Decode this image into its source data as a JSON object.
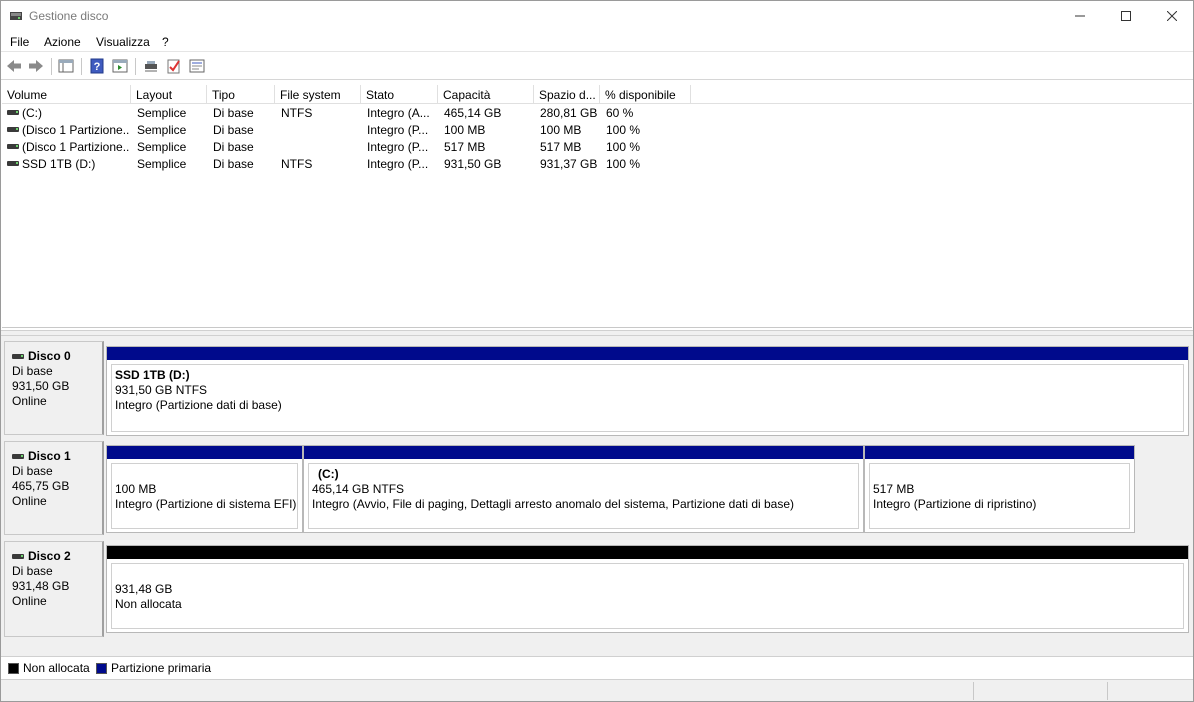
{
  "window": {
    "title": "Gestione disco",
    "controls": {
      "minimize": "minimize-icon",
      "maximize": "maximize-icon",
      "close": "close-icon"
    }
  },
  "menu": [
    "File",
    "Azione",
    "Visualizza",
    "?"
  ],
  "toolbar": {
    "buttons": [
      "back-icon",
      "forward-icon",
      "console-tree-icon",
      "help-icon",
      "show-action-pane-icon",
      "connect-disk-icon",
      "check-icon",
      "properties-icon"
    ]
  },
  "volumes": {
    "columns": [
      "Volume",
      "Layout",
      "Tipo",
      "File system",
      "Stato",
      "Capacità",
      "Spazio d...",
      "% disponibile"
    ],
    "rows": [
      [
        "(C:)",
        "Semplice",
        "Di base",
        "NTFS",
        "Integro (A...",
        "465,14 GB",
        "280,81 GB",
        "60 %"
      ],
      [
        "(Disco 1 Partizione...",
        "Semplice",
        "Di base",
        "",
        "Integro (P...",
        "100 MB",
        "100 MB",
        "100 %"
      ],
      [
        "(Disco 1 Partizione...",
        "Semplice",
        "Di base",
        "",
        "Integro (P...",
        "517 MB",
        "517 MB",
        "100 %"
      ],
      [
        "SSD 1TB (D:)",
        "Semplice",
        "Di base",
        "NTFS",
        "Integro (P...",
        "931,50 GB",
        "931,37 GB",
        "100 %"
      ]
    ]
  },
  "disks": [
    {
      "name": "Disco 0",
      "type": "Di base",
      "size": "931,50 GB",
      "status": "Online",
      "partitions": [
        {
          "title": "SSD 1TB  (D:)",
          "size": "931,50 GB NTFS",
          "status": "Integro (Partizione dati di base)"
        }
      ]
    },
    {
      "name": "Disco 1",
      "type": "Di base",
      "size": "465,75 GB",
      "status": "Online",
      "partitions": [
        {
          "title": "",
          "size": "100 MB",
          "status": "Integro (Partizione di sistema EFI)"
        },
        {
          "title": "(C:)",
          "size": "465,14 GB NTFS",
          "status": "Integro (Avvio, File di paging, Dettagli arresto anomalo del sistema, Partizione dati di base)"
        },
        {
          "title": "",
          "size": "517 MB",
          "status": "Integro (Partizione di ripristino)"
        }
      ]
    },
    {
      "name": "Disco 2",
      "type": "Di base",
      "size": "931,48 GB",
      "status": "Online",
      "partitions": [
        {
          "title": "",
          "size": "931,48 GB",
          "status": "Non allocata"
        }
      ]
    }
  ],
  "legend": [
    {
      "label": "Non allocata",
      "color": "#000000"
    },
    {
      "label": "Partizione primaria",
      "color": "#000a8c"
    }
  ]
}
